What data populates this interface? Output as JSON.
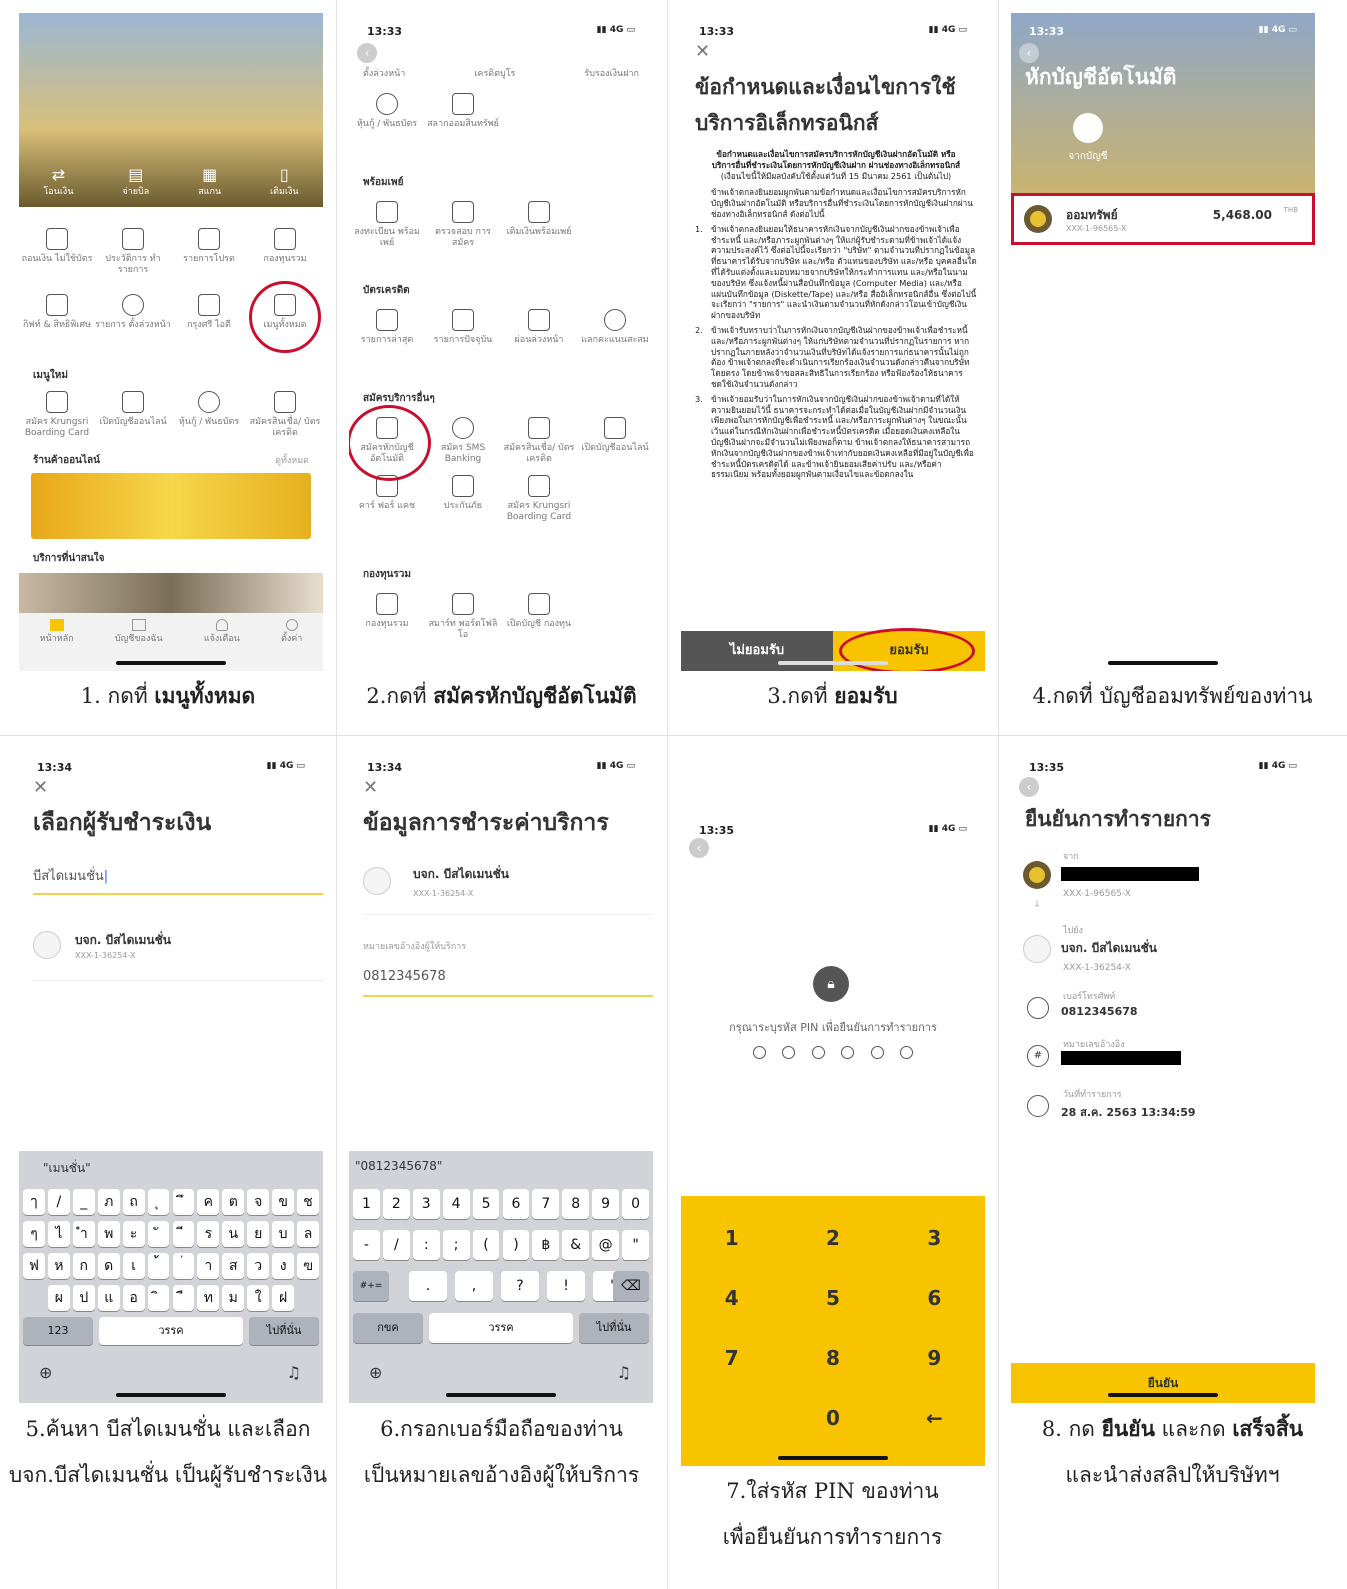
{
  "captions": {
    "c1_pre": "1. กดที่ ",
    "c1_bold": "เมนูทั้งหมด",
    "c2_pre": "2.กดที่ ",
    "c2_bold": "สมัครหักบัญชีอัตโนมัติ",
    "c3_pre": "3.กดที่ ",
    "c3_bold": "ยอมรับ",
    "c4": "4.กดที่ บัญชีออมทรัพย์ของท่าน",
    "c5_l1": "5.ค้นหา บีสไดเมนชั่น และเลือก",
    "c5_l2": "บจก.บีสไดเมนชั่น เป็นผู้รับชำระเงิน",
    "c6_l1": "6.กรอกเบอร์มือถือของท่าน",
    "c6_l2": "เป็นหมายเลขอ้างอิงผู้ให้บริการ",
    "c7_l1": "7.ใส่รหัส PIN ของท่าน",
    "c7_l2": "เพื่อยืนยันการทำรายการ",
    "c8_pre": "8. กด ",
    "c8_b1": "ยืนยัน",
    "c8_mid": " และกด ",
    "c8_b2": "เสร็จสิ้น",
    "c8_l2": "และนำส่งสลิปให้บริษัทฯ"
  },
  "s1": {
    "top_actions": [
      "โอนเงิน",
      "จ่ายบิล",
      "สแกน",
      "เติมเงิน"
    ],
    "menu": [
      "ถอนเงิน ไม่ใช้บัตร",
      "ประวัติการ ทำรายการ",
      "รายการโปรด",
      "กองทุนรวม",
      "กิฟท์ & สิทธิพิเศษ",
      "รายการ ตั้งล่วงหน้า",
      "กรุงศรี ไอดี",
      "เมนูทั้งหมด"
    ],
    "new_menu_title": "เมนูใหม่",
    "new_menu": [
      "สมัคร Krungsri Boarding Card",
      "เปิดบัญชีออนไลน์",
      "หุ้นกู้ / พันธบัตร",
      "สมัครสินเชื่อ/ บัตรเครดิต"
    ],
    "shop_title": "ร้านค้าออนไลน์",
    "shop_more": "ดูทั้งหมด",
    "interest_title": "บริการที่น่าสนใจ",
    "tabs": [
      "หน้าหลัก",
      "บัญชีของฉัน",
      "แจ้งเตือน",
      "ตั้งค่า"
    ]
  },
  "s2": {
    "time": "13:33",
    "top_tabs": [
      "ตั้งล่วงหน้า",
      "เครดิตบูโร",
      "รับรองเงินฝาก"
    ],
    "row0": [
      "หุ้นกู้ / พันธบัตร",
      "สลากออมสินทรัพย์"
    ],
    "sec_promptpay": "พร้อมเพย์",
    "promptpay": [
      "ลงทะเบียน พร้อมเพย์",
      "ตรวจสอบ การสมัคร",
      "เติมเงินพร้อมเพย์"
    ],
    "sec_card": "บัตรเครดิต",
    "card": [
      "รายการล่าสุด",
      "รายการปัจจุบัน",
      "ผ่อนล่วงหน้า",
      "แลกคะแนนสะสม"
    ],
    "sec_other": "สมัครบริการอื่นๆ",
    "other": [
      "สมัครหักบัญชี อัตโนมัติ",
      "สมัคร SMS Banking",
      "สมัครสินเชื่อ/ บัตรเครดิต",
      "เปิดบัญชีออนไลน์",
      "คาร์ ฟอร์ แคช",
      "ประกันภัย",
      "สมัคร Krungsri Boarding Card"
    ],
    "sec_fund": "กองทุนรวม",
    "fund": [
      "กองทุนรวม",
      "สมาร์ท พอร์ตโฟลิโอ",
      "เปิดบัญชี กองทุน"
    ]
  },
  "s3": {
    "time": "13:33",
    "title": "ข้อกำหนดและเงื่อนไขการใช้บริการอิเล็กทรอนิกส์",
    "head": "ข้อกำหนดและเงื่อนไขการสมัครบริการหักบัญชีเงินฝากอัตโนมัติ หรือบริการอื่นที่ชำระเงินโดยการหักบัญชีเงินฝาก ผ่านช่องทางอิเล็กทรอนิกส์",
    "sub": "(เงื่อนไขนี้ให้มีผลบังคับใช้ตั้งแต่วันที่ 15 มีนาคม 2561 เป็นต้นไป)",
    "p0": "ข้าพเจ้าตกลงยินยอมผูกพันตามข้อกำหนดและเงื่อนไขการสมัครบริการหักบัญชีเงินฝากอัตโนมัติ หรือบริการอื่นที่ชำระเงินโดยการหักบัญชีเงินฝากผ่านช่องทางอิเล็กทรอนิกส์ ดังต่อไปนี้",
    "p1": "ข้าพเจ้าตกลงยินยอมให้ธนาคารหักเงินจากบัญชีเงินฝากของข้าพเจ้าเพื่อชำระหนี้ และ/หรือภาระผูกพันต่างๆ ให้แก่ผู้รับชำระตามที่ข้าพเจ้าได้แจ้งความประสงค์ไว้ ซึ่งต่อไปนี้จะเรียกว่า \"บริษัท\" ตามจำนวนที่ปรากฏในข้อมูลที่ธนาคารได้รับจากบริษัท และ/หรือ ตัวแทนของบริษัท และ/หรือ บุคคลอื่นใดที่ได้รับแต่งตั้งและมอบหมายจากบริษัทให้กระทำการแทน และ/หรือในนามของบริษัท ซึ่งแจ้งหนี้ผ่านสื่อบันทึกข้อมูล (Computer Media) และ/หรือ แผ่นบันทึกข้อมูล (Diskette/Tape) และ/หรือ สื่ออิเล็กทรอนิกส์อื่น ซึ่งต่อไปนี้จะเรียกว่า \"รายการ\" และนำเงินตามจำนวนที่หักดังกล่าวโอนเข้าบัญชีเงินฝากของบริษัท",
    "p2": "ข้าพเจ้ารับทราบว่าในการหักเงินจากบัญชีเงินฝากของข้าพเจ้าเพื่อชำระหนี้ และ/หรือภาระผูกพันต่างๆ ให้แก่บริษัทตามจำนวนที่ปรากฏในรายการ หากปรากฏในภายหลังว่าจำนวนเงินที่บริษัทได้แจ้งรายการแก่ธนาคารนั้นไม่ถูกต้อง ข้าพเจ้าตกลงที่จะดำเนินการเรียกร้องเงินจำนวนดังกล่าวคืนจากบริษัทโดยตรง โดยข้าพเจ้าขอสละสิทธิในการเรียกร้อง หรือฟ้องร้องให้ธนาคารชดใช้เงินจำนวนดังกล่าว",
    "p3": "ข้าพเจ้ายอมรับว่าในการหักเงินจากบัญชีเงินฝากของข้าพเจ้าตามที่ได้ให้ความยินยอมไว้นี้ ธนาคารจะกระทำได้ต่อเมื่อในบัญชีเงินฝากมีจำนวนเงินเพียงพอในการหักบัญชีเพื่อชำระหนี้ และ/หรือภาระผูกพันต่างๆ ในขณะนั้น เว้นแต่ในกรณีหักเงินฝากเพื่อชำระหนี้บัตรเครดิต เมื่อยอดเงินคงเหลือในบัญชีเงินฝากจะมีจำนวนไม่เพียงพอก็ตาม ข้าพเจ้าตกลงให้ธนาคารสามารถหักเงินจากบัญชีเงินฝากของข้าพเจ้าเท่ากับยอดเงินคงเหลือที่มีอยู่ในบัญชีเพื่อชำระหนี้บัตรเครดิตได้ และข้าพเจ้ายินยอมเสียค่าปรับ และ/หรือค่าธรรมเนียม พร้อมทั้งยอมผูกพันตามเงื่อนไขและข้อตกลงใน",
    "decline": "ไม่ยอมรับ",
    "accept": "ยอมรับ"
  },
  "s4": {
    "time": "13:33",
    "title": "หักบัญชีอัตโนมัติ",
    "from_label": "จากบัญชี",
    "account_name": "ออมทรัพย์",
    "account_no": "XXX-1-96565-X",
    "amount": "5,468.00",
    "currency": "THB"
  },
  "s5": {
    "time": "13:34",
    "title": "เลือกผู้รับชำระเงิน",
    "search_value": "บีสไดเมนชั่น",
    "result_name": "บจก. บีสไดเมนชั่น",
    "result_no": "XXX-1-36254-X",
    "suggest": "\"เมนชั่น\"",
    "rows": [
      [
        "ๅ",
        "/",
        "_",
        "ภ",
        "ถ",
        "ุ",
        "ึ",
        "ค",
        "ต",
        "จ",
        "ข",
        "ช"
      ],
      [
        "ๆ",
        "ไ",
        "ำ",
        "พ",
        "ะ",
        "ั",
        "ี",
        "ร",
        "น",
        "ย",
        "บ",
        "ล"
      ],
      [
        "ฟ",
        "ห",
        "ก",
        "ด",
        "เ",
        "้",
        "่",
        "า",
        "ส",
        "ว",
        "ง",
        "ฃ"
      ],
      [
        "ผ",
        "ป",
        "แ",
        "อ",
        "ิ",
        "ื",
        "ท",
        "ม",
        "ใ",
        "ฝ"
      ]
    ],
    "k123": "123",
    "space": "วรรค",
    "ret": "ไปที่นั่น"
  },
  "s6": {
    "time": "13:34",
    "title": "ข้อมูลการชำระค่าบริการ",
    "biller_name": "บจก. บีสไดเมนชั่น",
    "biller_no": "XXX-1-36254-X",
    "ref_label": "หมายเลขอ้างอิงผู้ให้บริการ",
    "ref_value": "0812345678",
    "suggest": "\"0812345678\"",
    "row1": [
      "1",
      "2",
      "3",
      "4",
      "5",
      "6",
      "7",
      "8",
      "9",
      "0"
    ],
    "row2": [
      "-",
      "/",
      ":",
      ";",
      "(",
      ")",
      "฿",
      "&",
      "@",
      "\""
    ],
    "row3": [
      ".",
      ",",
      "?",
      "!",
      "'"
    ],
    "kabc": "#+=",
    "kthai": "กขค",
    "space": "วรรค",
    "ret": "ไปที่นั่น"
  },
  "s7": {
    "time": "13:35",
    "prompt": "กรุณาระบุรหัส PIN เพื่อยืนยันการทำรายการ",
    "pad": [
      "1",
      "2",
      "3",
      "4",
      "5",
      "6",
      "7",
      "8",
      "9",
      "",
      "0",
      "←"
    ]
  },
  "s8": {
    "time": "13:35",
    "title": "ยืนยันการทำรายการ",
    "from_label": "จาก",
    "from_no": "XXX-1-96565-X",
    "to_label": "ไปยัง",
    "to_name": "บจก. บีสไดเมนชั่น",
    "to_no": "XXX-1-36254-X",
    "ref1_label": "เบอร์โทรศัพท์",
    "ref1_value": "0812345678",
    "ref2_label": "หมายเลขอ้างอิง",
    "date_label": "วันที่ทำรายการ",
    "date_value": "28 ส.ค. 2563 13:34:59",
    "confirm": "ยืนยัน"
  },
  "colors": {
    "brand_yellow": "#f8c400",
    "highlight_red": "#c8102e",
    "dark": "#333333"
  }
}
